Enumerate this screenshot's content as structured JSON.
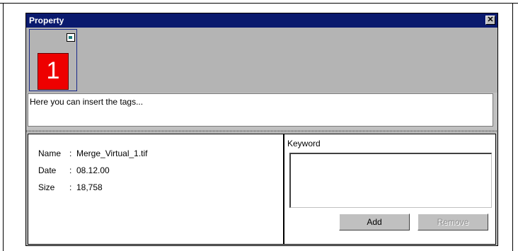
{
  "window": {
    "title": "Property",
    "close_label": "✕"
  },
  "thumbnail": {
    "number": "1",
    "color": "#ee0000"
  },
  "tags": {
    "placeholder": "Here you can insert the tags..."
  },
  "info": {
    "name_label": "Name",
    "name_value": "Merge_Virtual_1.tif",
    "date_label": "Date",
    "date_value": "08.12.00",
    "size_label": "Size",
    "size_value": "18,758",
    "separator": ":"
  },
  "keyword": {
    "label": "Keyword",
    "value": "",
    "add_label": "Add",
    "remove_label": "Remove"
  },
  "colors": {
    "titlebar": "#0a1a6e",
    "panel": "#c0c0c0",
    "thumb_area": "#b4b4b4"
  }
}
